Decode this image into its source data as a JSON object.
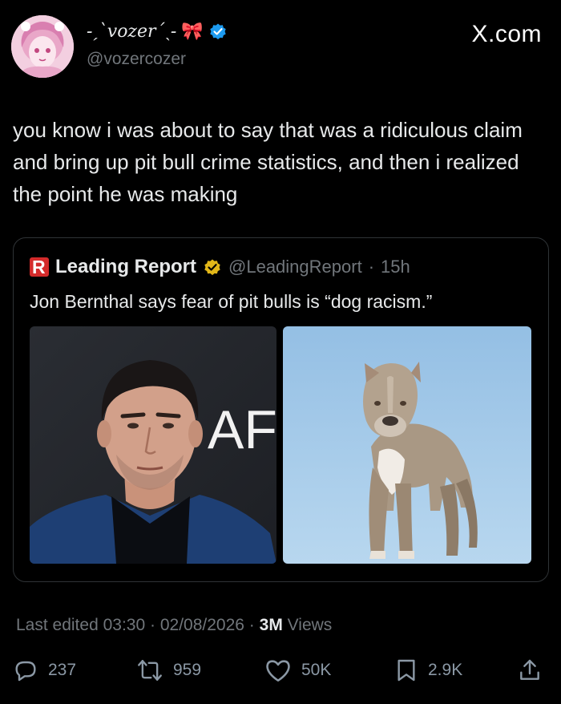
{
  "author": {
    "display_name": "-ˏˋvozerˊˎ-",
    "bow_emoji": "🎀",
    "handle": "@vozercozer",
    "verified": true
  },
  "watermark": "X.com",
  "tweet": {
    "text": "you know i was about to say that was a ridiculous claim and bring up pit bull crime statistics, and then i realized the point he was making"
  },
  "quote": {
    "logo_letter": "R",
    "name": "Leading Report",
    "handle": "@LeadingReport",
    "separator": "·",
    "time": "15h",
    "text": "Jon Bernthal says fear of pit bulls is “dog racism.”",
    "media": [
      {
        "description": "man",
        "backdrop_text": "AFI"
      },
      {
        "description": "pit bull"
      }
    ]
  },
  "meta": {
    "edited_label": "Last edited",
    "time": "03:30",
    "date": "02/08/2026",
    "dot1": "·",
    "dot2": "·",
    "views_count": "3M",
    "views_label": "Views"
  },
  "actions": {
    "replies": "237",
    "reposts": "959",
    "likes": "50K",
    "bookmarks": "2.9K"
  },
  "colors": {
    "background": "#000000",
    "text": "#e7e9ea",
    "muted": "#71767b",
    "border": "#2f3336",
    "verified_blue": "#1d9bf0",
    "verified_gold": "#e2b719",
    "logo_red": "#d42b2b"
  },
  "icons": [
    "verified-badge-icon",
    "gold-verified-badge-icon",
    "reply-icon",
    "repost-icon",
    "like-icon",
    "bookmark-icon",
    "share-icon"
  ]
}
